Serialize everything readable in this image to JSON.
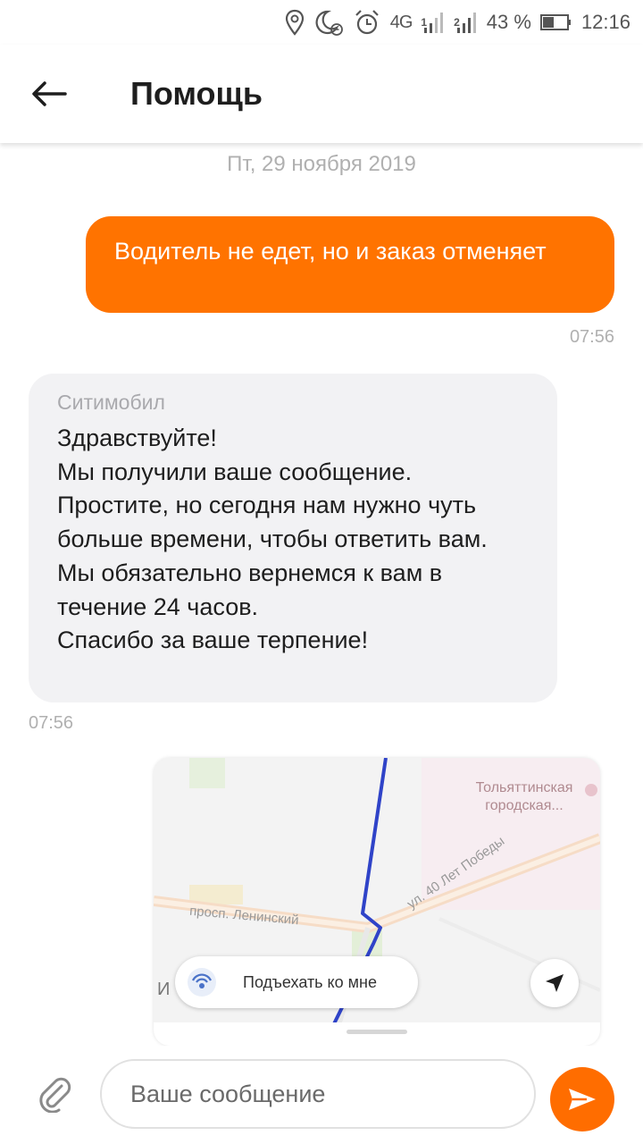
{
  "status_bar": {
    "network": "4G",
    "sim1": "1",
    "sim2": "2",
    "battery": "43 %",
    "time": "12:16",
    "icons": [
      "location-icon",
      "do-not-disturb-moon-icon",
      "alarm-clock-icon",
      "signal-icon",
      "battery-icon"
    ]
  },
  "header": {
    "title": "Помощь",
    "back_icon": "arrow-left-icon"
  },
  "chat": {
    "date": "Пт, 29 ноября 2019",
    "outgoing": {
      "text": "Водитель не едет, но и заказ отменяет",
      "time": "07:56"
    },
    "incoming": {
      "sender": "Ситимобил",
      "text": "Здравствуйте!\nМы получили ваше сообщение. Простите, но сегодня нам нужно чуть больше времени, чтобы ответить вам. Мы обязательно вернемся к вам в течение 24 часов.\nСпасибо за ваше терпение!",
      "time": "07:56"
    },
    "map_card": {
      "place_label": "Тольяттинская городская...",
      "street_1": "просп. Ленинский",
      "street_2": "ул. 40 Лет Победы",
      "pickup_label": "Подъехать ко мне",
      "attribution": "И"
    }
  },
  "composer": {
    "placeholder": "Ваше сообщение",
    "attach_icon": "paperclip-icon",
    "send_icon": "send-arrow-icon"
  },
  "colors": {
    "accent": "#ff7300",
    "incoming_bubble": "#f2f2f4",
    "route": "#2f43c8"
  }
}
